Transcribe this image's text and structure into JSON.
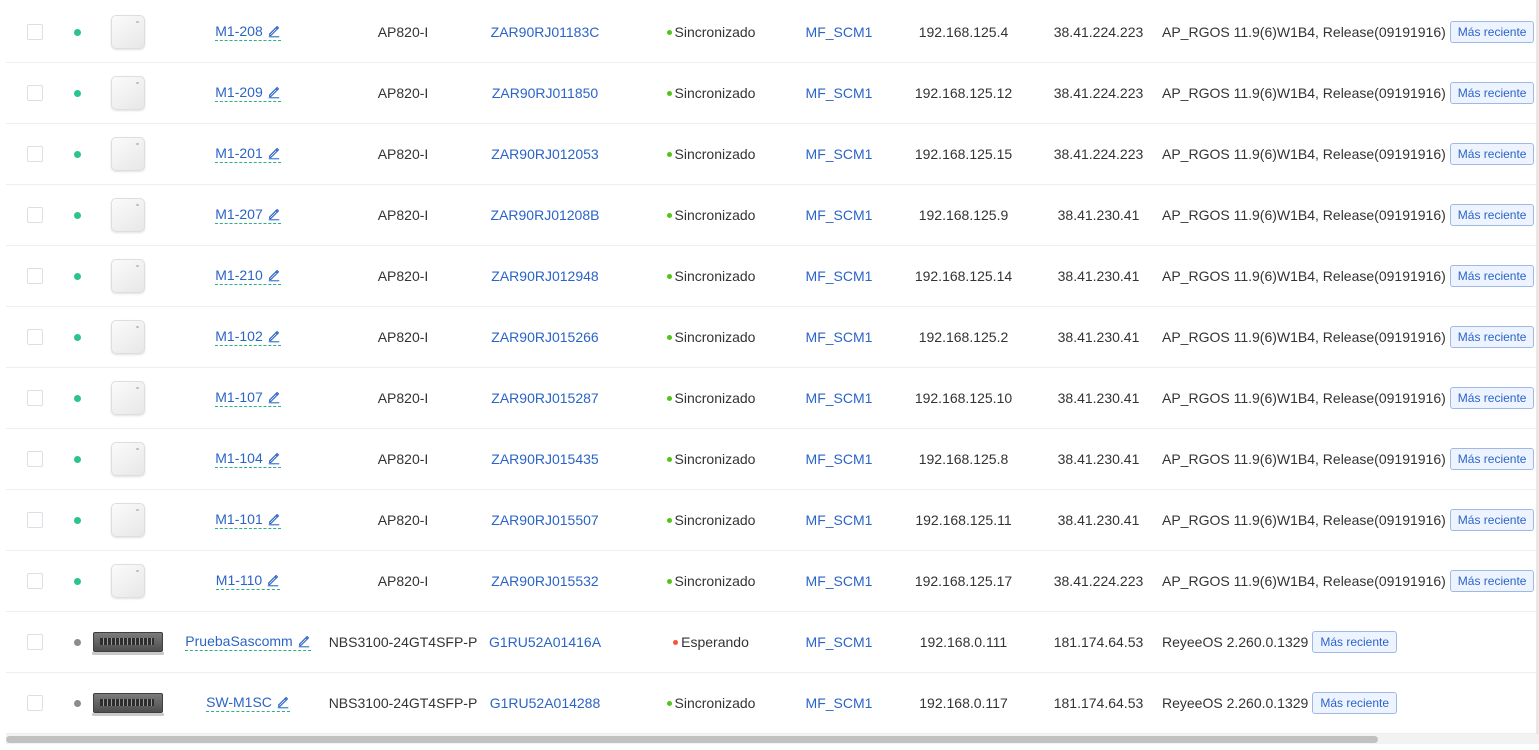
{
  "table": {
    "rows": [
      {
        "type": "ap",
        "status": "online",
        "name": "M1-208",
        "model": "AP820-I",
        "sn": "ZAR90RJ01183C",
        "state": "Sincronizado",
        "state_color": "green",
        "group": "MF_SCM1",
        "ip": "192.168.125.4",
        "public_ip": "38.41.224.223",
        "firmware": "AP_RGOS 11.9(6)W1B4, Release(09191916)",
        "badge": "Más reciente"
      },
      {
        "type": "ap",
        "status": "online",
        "name": "M1-209",
        "model": "AP820-I",
        "sn": "ZAR90RJ011850",
        "state": "Sincronizado",
        "state_color": "green",
        "group": "MF_SCM1",
        "ip": "192.168.125.12",
        "public_ip": "38.41.224.223",
        "firmware": "AP_RGOS 11.9(6)W1B4, Release(09191916)",
        "badge": "Más reciente"
      },
      {
        "type": "ap",
        "status": "online",
        "name": "M1-201",
        "model": "AP820-I",
        "sn": "ZAR90RJ012053",
        "state": "Sincronizado",
        "state_color": "green",
        "group": "MF_SCM1",
        "ip": "192.168.125.15",
        "public_ip": "38.41.224.223",
        "firmware": "AP_RGOS 11.9(6)W1B4, Release(09191916)",
        "badge": "Más reciente"
      },
      {
        "type": "ap",
        "status": "online",
        "name": "M1-207",
        "model": "AP820-I",
        "sn": "ZAR90RJ01208B",
        "state": "Sincronizado",
        "state_color": "green",
        "group": "MF_SCM1",
        "ip": "192.168.125.9",
        "public_ip": "38.41.230.41",
        "firmware": "AP_RGOS 11.9(6)W1B4, Release(09191916)",
        "badge": "Más reciente"
      },
      {
        "type": "ap",
        "status": "online",
        "name": "M1-210",
        "model": "AP820-I",
        "sn": "ZAR90RJ012948",
        "state": "Sincronizado",
        "state_color": "green",
        "group": "MF_SCM1",
        "ip": "192.168.125.14",
        "public_ip": "38.41.230.41",
        "firmware": "AP_RGOS 11.9(6)W1B4, Release(09191916)",
        "badge": "Más reciente"
      },
      {
        "type": "ap",
        "status": "online",
        "name": "M1-102",
        "model": "AP820-I",
        "sn": "ZAR90RJ015266",
        "state": "Sincronizado",
        "state_color": "green",
        "group": "MF_SCM1",
        "ip": "192.168.125.2",
        "public_ip": "38.41.230.41",
        "firmware": "AP_RGOS 11.9(6)W1B4, Release(09191916)",
        "badge": "Más reciente"
      },
      {
        "type": "ap",
        "status": "online",
        "name": "M1-107",
        "model": "AP820-I",
        "sn": "ZAR90RJ015287",
        "state": "Sincronizado",
        "state_color": "green",
        "group": "MF_SCM1",
        "ip": "192.168.125.10",
        "public_ip": "38.41.230.41",
        "firmware": "AP_RGOS 11.9(6)W1B4, Release(09191916)",
        "badge": "Más reciente"
      },
      {
        "type": "ap",
        "status": "online",
        "name": "M1-104",
        "model": "AP820-I",
        "sn": "ZAR90RJ015435",
        "state": "Sincronizado",
        "state_color": "green",
        "group": "MF_SCM1",
        "ip": "192.168.125.8",
        "public_ip": "38.41.230.41",
        "firmware": "AP_RGOS 11.9(6)W1B4, Release(09191916)",
        "badge": "Más reciente"
      },
      {
        "type": "ap",
        "status": "online",
        "name": "M1-101",
        "model": "AP820-I",
        "sn": "ZAR90RJ015507",
        "state": "Sincronizado",
        "state_color": "green",
        "group": "MF_SCM1",
        "ip": "192.168.125.11",
        "public_ip": "38.41.230.41",
        "firmware": "AP_RGOS 11.9(6)W1B4, Release(09191916)",
        "badge": "Más reciente"
      },
      {
        "type": "ap",
        "status": "online",
        "name": "M1-110",
        "model": "AP820-I",
        "sn": "ZAR90RJ015532",
        "state": "Sincronizado",
        "state_color": "green",
        "group": "MF_SCM1",
        "ip": "192.168.125.17",
        "public_ip": "38.41.224.223",
        "firmware": "AP_RGOS 11.9(6)W1B4, Release(09191916)",
        "badge": "Más reciente"
      },
      {
        "type": "switch",
        "status": "offline",
        "name": "PruebaSascomm",
        "model": "NBS3100-24GT4SFP-P",
        "sn": "G1RU52A01416A",
        "state": "Esperando",
        "state_color": "red",
        "group": "MF_SCM1",
        "ip": "192.168.0.111",
        "public_ip": "181.174.64.53",
        "firmware": "ReyeeOS 2.260.0.1329",
        "badge": "Más reciente"
      },
      {
        "type": "switch",
        "status": "offline",
        "name": "SW-M1SC",
        "model": "NBS3100-24GT4SFP-P",
        "sn": "G1RU52A014288",
        "state": "Sincronizado",
        "state_color": "green",
        "group": "MF_SCM1",
        "ip": "192.168.0.117",
        "public_ip": "181.174.64.53",
        "firmware": "ReyeeOS 2.260.0.1329",
        "badge": "Más reciente"
      }
    ]
  },
  "icons": {
    "edit": "pencil-icon",
    "access_point": "access-point-device-icon",
    "switch": "network-switch-device-icon"
  },
  "colors": {
    "link": "#2b64c8",
    "online": "#2bc48a",
    "offline": "#8c8c8c",
    "synced": "#52c41a",
    "waiting": "#f5533d",
    "badge_border": "#9fb9e6",
    "badge_bg": "#eef4ff"
  }
}
